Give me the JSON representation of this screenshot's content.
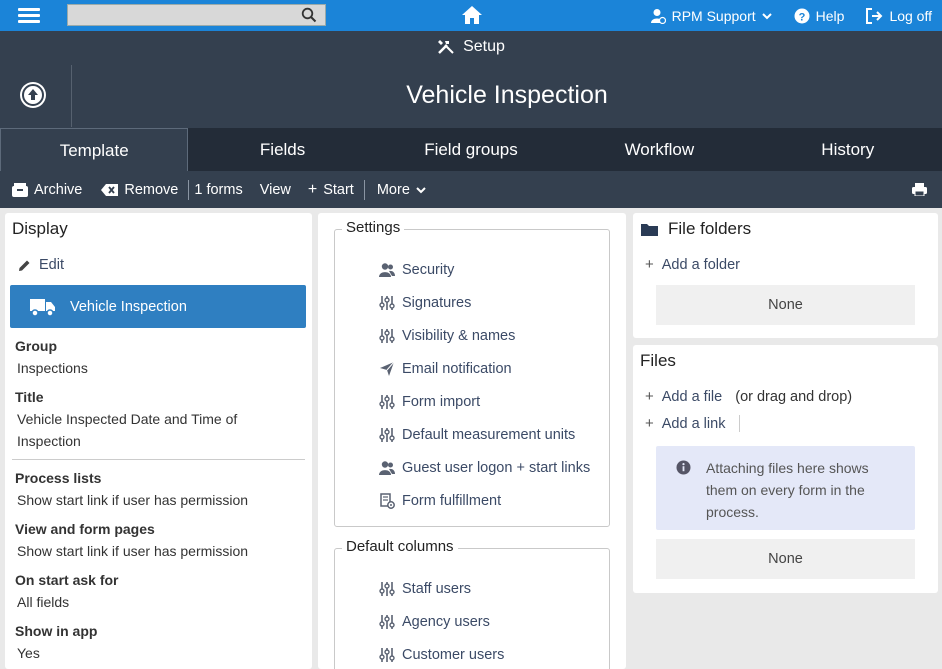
{
  "topbar": {
    "search_placeholder": "",
    "user_label": "RPM Support",
    "help_label": "Help",
    "logoff_label": "Log off"
  },
  "header": {
    "section_label": "Setup",
    "page_title": "Vehicle Inspection"
  },
  "tabs": [
    {
      "label": "Template",
      "active": true
    },
    {
      "label": "Fields",
      "active": false
    },
    {
      "label": "Field groups",
      "active": false
    },
    {
      "label": "Workflow",
      "active": false
    },
    {
      "label": "History",
      "active": false
    }
  ],
  "toolbar": {
    "archive": "Archive",
    "remove": "Remove",
    "forms_count": "1 forms",
    "view": "View",
    "start": "Start",
    "more": "More"
  },
  "display": {
    "heading": "Display",
    "edit": "Edit",
    "process_name": "Vehicle Inspection",
    "fields": [
      {
        "label": "Group",
        "value": "Inspections"
      },
      {
        "label": "Title",
        "value": "Vehicle Inspected Date and Time of Inspection"
      },
      {
        "label": "Process lists",
        "value": "Show start link if user has permission"
      },
      {
        "label": "View and form pages",
        "value": "Show start link if user has permission"
      },
      {
        "label": "On start ask for",
        "value": "All fields"
      },
      {
        "label": "Show in app",
        "value": "Yes"
      }
    ]
  },
  "settings": {
    "legend": "Settings",
    "items": [
      {
        "label": "Security",
        "icon": "users-icon"
      },
      {
        "label": "Signatures",
        "icon": "sliders-icon"
      },
      {
        "label": "Visibility & names",
        "icon": "sliders-icon"
      },
      {
        "label": "Email notification",
        "icon": "paper-plane-icon"
      },
      {
        "label": "Form import",
        "icon": "sliders-icon"
      },
      {
        "label": "Default measurement units",
        "icon": "sliders-icon"
      },
      {
        "label": "Guest user logon + start links",
        "icon": "users-icon"
      },
      {
        "label": "Form fulfillment",
        "icon": "form-fulfillment-icon"
      }
    ]
  },
  "default_columns": {
    "legend": "Default columns",
    "items": [
      {
        "label": "Staff users",
        "icon": "sliders-icon"
      },
      {
        "label": "Agency users",
        "icon": "sliders-icon"
      },
      {
        "label": "Customer users",
        "icon": "sliders-icon"
      }
    ]
  },
  "file_folders": {
    "heading": "File folders",
    "add_folder": "Add a folder",
    "none": "None"
  },
  "files": {
    "heading": "Files",
    "add_file": "Add a file",
    "drag_hint": "(or drag and drop)",
    "add_link": "Add a link",
    "info": "Attaching files here shows them on every form in the process.",
    "none": "None"
  },
  "colors": {
    "topbar": "#1b84d8",
    "header": "#34404f",
    "tabs": "#232c38",
    "selected": "#2f7fc1",
    "link": "#3b4a66"
  }
}
